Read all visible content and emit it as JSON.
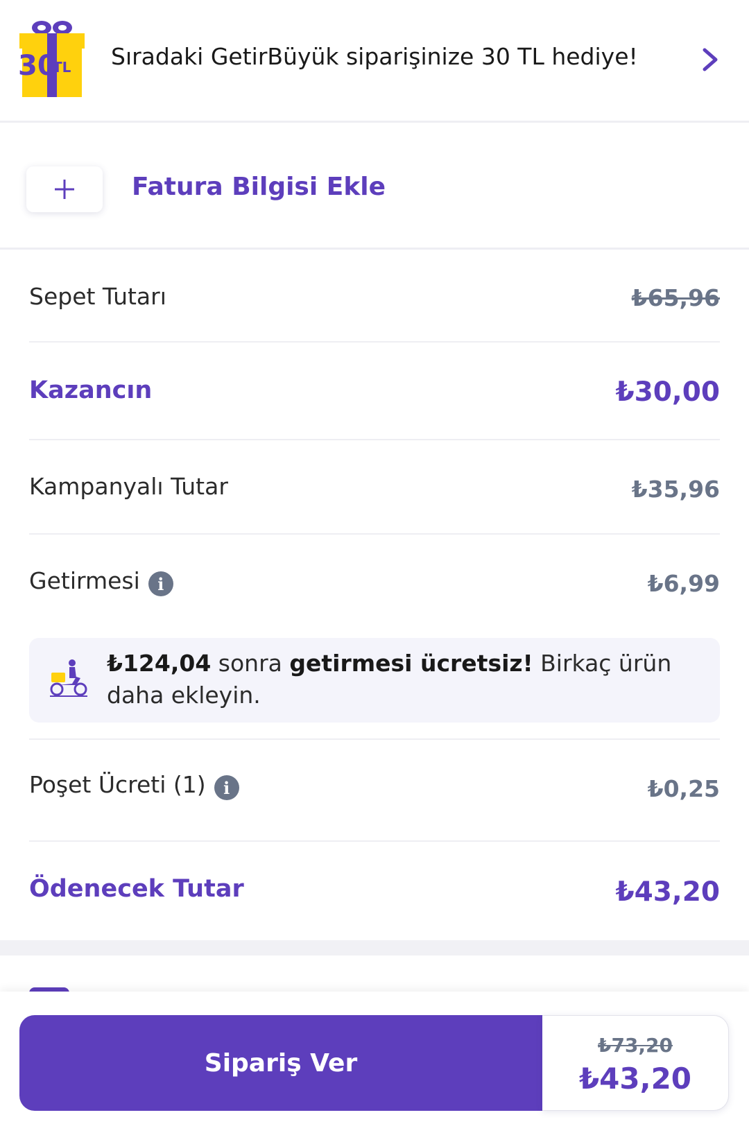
{
  "promo": {
    "badge_amount": "30",
    "badge_unit": "TL",
    "text": "Sıradaki GetirBüyük siparişinize 30 TL hediye!",
    "chevron_icon": "chevron-right-icon"
  },
  "invoice": {
    "plus_icon": "plus-icon",
    "label": "Fatura Bilgisi Ekle"
  },
  "summary": {
    "basket_label": "Sepet Tutarı",
    "basket_value": "₺65,96",
    "savings_label": "Kazancın",
    "savings_value": "₺30,00",
    "campaign_label": "Kampanyalı Tutar",
    "campaign_value": "₺35,96",
    "delivery_label": "Getirmesi",
    "delivery_value": "₺6,99",
    "free_delivery": {
      "amount": "₺124,04",
      "text_1": " sonra ",
      "bold_text": "getirmesi ücretsiz!",
      "text_2": " Birkaç ürün daha ekleyin."
    },
    "bag_label": "Poşet Ücreti (1)",
    "bag_value": "₺0,25",
    "total_label": "Ödenecek Tutar",
    "total_value": "₺43,20"
  },
  "footer": {
    "order_button": "Sipariş Ver",
    "old_price": "₺73,20",
    "new_price": "₺43,20"
  },
  "colors": {
    "brand_purple": "#5d3ebc",
    "brand_yellow": "#ffd10d",
    "muted_gray": "#697488"
  }
}
